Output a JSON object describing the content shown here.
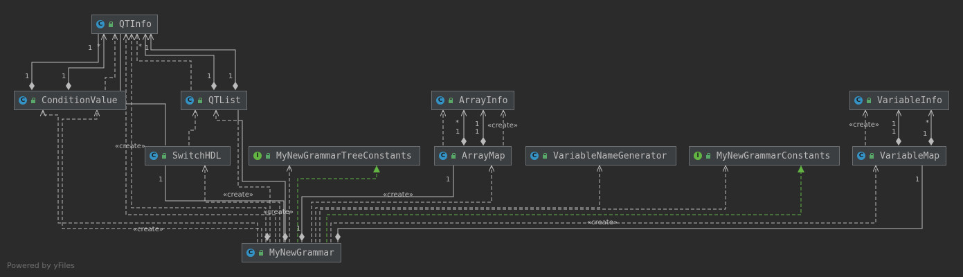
{
  "nodes": {
    "qtinfo": {
      "name": "QTInfo",
      "kind": "class"
    },
    "conditionvalue": {
      "name": "ConditionValue",
      "kind": "class"
    },
    "qtlist": {
      "name": "QTList",
      "kind": "class"
    },
    "switchhdl": {
      "name": "SwitchHDL",
      "kind": "class"
    },
    "treeconstants": {
      "name": "MyNewGrammarTreeConstants",
      "kind": "interface"
    },
    "arrayinfo": {
      "name": "ArrayInfo",
      "kind": "class"
    },
    "arraymap": {
      "name": "ArrayMap",
      "kind": "class"
    },
    "varnamegen": {
      "name": "VariableNameGenerator",
      "kind": "class"
    },
    "grammarconstants": {
      "name": "MyNewGrammarConstants",
      "kind": "interface"
    },
    "variableinfo": {
      "name": "VariableInfo",
      "kind": "class"
    },
    "variablemap": {
      "name": "VariableMap",
      "kind": "class"
    },
    "mynewgrammar": {
      "name": "MyNewGrammar",
      "kind": "class"
    }
  },
  "icons": {
    "class": "C",
    "interface": "I"
  },
  "labels": {
    "create": "«create»",
    "one": "1",
    "many": "*"
  },
  "footer": "Powered by yFiles"
}
